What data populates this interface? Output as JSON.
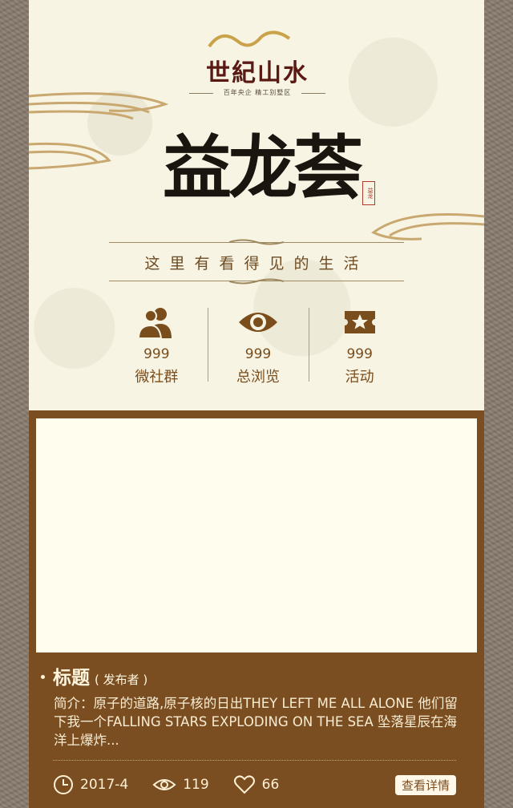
{
  "header": {
    "logo": {
      "title": "世紀山水",
      "subtitle": "百年央企  精工别墅区"
    },
    "brand_title": "益龙荟",
    "seal_text": "益龙",
    "slogan": "这里有看得见的生活"
  },
  "stats": [
    {
      "icon": "group-icon",
      "count": "999",
      "label": "微社群"
    },
    {
      "icon": "eye-icon",
      "count": "999",
      "label": "总浏览"
    },
    {
      "icon": "ticket-star-icon",
      "count": "999",
      "label": "活动"
    }
  ],
  "card": {
    "title": "标题",
    "publisher": "( 发布者 )",
    "description": "简介：原子的道路,原子核的日出THEY LEFT ME ALL ALONE 他们留下我一个FALLING STARS EXPLODING ON THE SEA 坠落星辰在海洋上爆炸...",
    "date": "2017-4",
    "views": "119",
    "likes": "66",
    "detail_label": "查看详情"
  },
  "colors": {
    "card_brown": "#7b4e22",
    "header_bg": "#f7f4e4",
    "accent_brown": "#7a4d1c",
    "frame": "#8a7c6f"
  }
}
